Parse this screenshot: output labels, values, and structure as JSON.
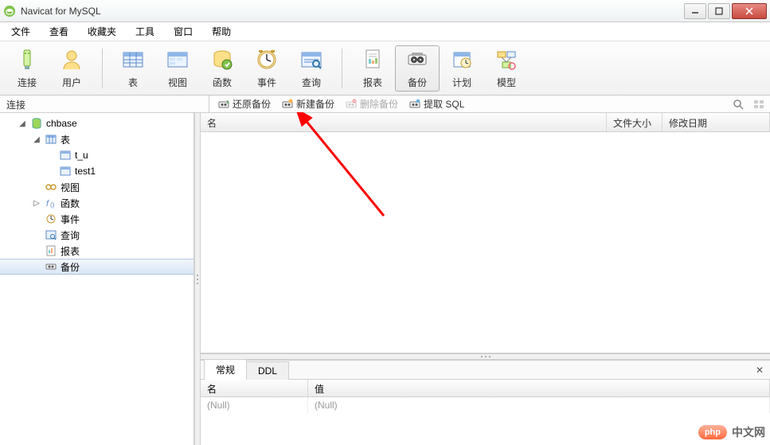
{
  "titlebar": {
    "title": "Navicat for MySQL"
  },
  "menu": {
    "file": "文件",
    "view": "查看",
    "favorites": "收藏夹",
    "tools": "工具",
    "window": "窗口",
    "help": "帮助"
  },
  "toolbar": {
    "connection": "连接",
    "user": "用户",
    "table": "表",
    "view": "视图",
    "function": "函数",
    "event": "事件",
    "query": "查询",
    "report": "报表",
    "backup": "备份",
    "schedule": "计划",
    "model": "模型"
  },
  "tabstrip": {
    "left_label": "连接"
  },
  "subtoolbar": {
    "restore": "还原备份",
    "new": "新建备份",
    "delete": "删除备份",
    "extract": "提取 SQL"
  },
  "tree": {
    "db": "chbase",
    "tables": "表",
    "table_items": [
      "t_u",
      "test1"
    ],
    "views": "视图",
    "functions": "函数",
    "events": "事件",
    "queries": "查询",
    "reports": "报表",
    "backups": "备份"
  },
  "list_headers": {
    "name": "名",
    "filesize": "文件大小",
    "modified": "修改日期"
  },
  "bottom": {
    "tab_general": "常规",
    "tab_ddl": "DDL",
    "col_name": "名",
    "col_value": "值",
    "row_name": "(Null)",
    "row_value": "(Null)"
  },
  "watermark": {
    "badge": "php",
    "text": "中文网"
  }
}
